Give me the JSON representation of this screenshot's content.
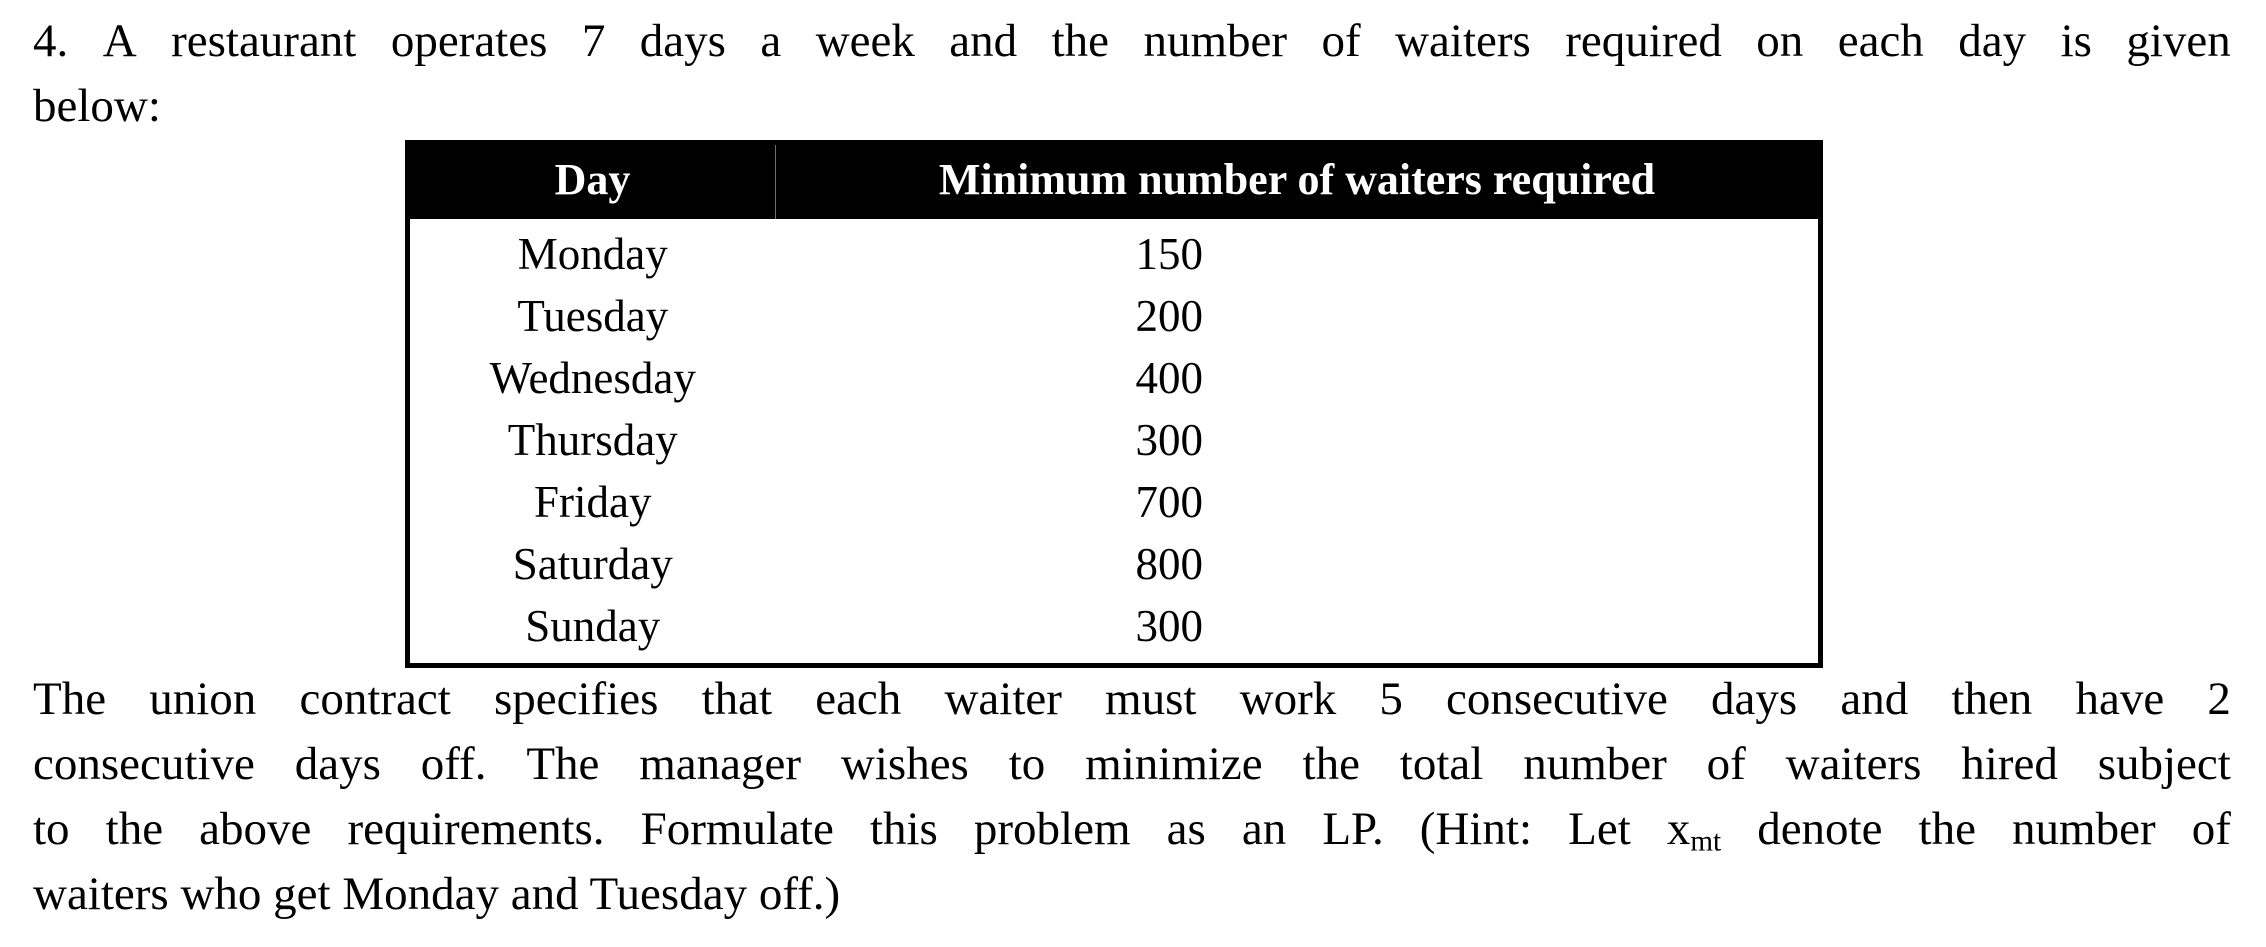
{
  "document": {
    "question_number": "4.",
    "intro": {
      "line1_words": [
        "4.",
        "A",
        "restaurant",
        "operates",
        "7",
        "days",
        "a",
        "week",
        "and",
        "the",
        "number",
        "of",
        "waiters",
        "required",
        "on",
        "each",
        "day",
        "is",
        "given"
      ],
      "line2": "below:",
      "full_text": "4. A restaurant operates 7 days a week and the number of waiters required on each day is given below:"
    },
    "table": {
      "headers": [
        "Day",
        "Minimum number of waiters required"
      ],
      "rows": [
        {
          "day": "Monday",
          "waiters": "150"
        },
        {
          "day": "Tuesday",
          "waiters": "200"
        },
        {
          "day": "Wednesday",
          "waiters": "400"
        },
        {
          "day": "Thursday",
          "waiters": "300"
        },
        {
          "day": "Friday",
          "waiters": "700"
        },
        {
          "day": "Saturday",
          "waiters": "800"
        },
        {
          "day": "Sunday",
          "waiters": "300"
        }
      ],
      "header_bg": "#000000",
      "header_fg": "#ffffff",
      "border_color": "#000000"
    },
    "closing": {
      "line1_words": [
        "The",
        "union",
        "contract",
        "specifies",
        "that",
        "each",
        "waiter",
        "must",
        "work",
        "5",
        "consecutive",
        "days",
        "and",
        "then",
        "have",
        "2"
      ],
      "line2_words": [
        "consecutive",
        "days",
        "off.",
        "The",
        "manager",
        "wishes",
        "to",
        "minimize",
        "the",
        "total",
        "number",
        "of",
        "waiters",
        "hired",
        "subject"
      ],
      "line3_a": "to the above requirements. Formulate this problem as an LP. (Hint: Let x",
      "line3_sub": "mt",
      "line3_b": " denote the number of",
      "line3_words_a": [
        "to",
        "the",
        "above",
        "requirements.",
        "Formulate",
        "this",
        "problem",
        "as",
        "an",
        "LP.",
        "(Hint:",
        "Let"
      ],
      "line4": "waiters who get Monday and Tuesday off.)",
      "full_text": "The union contract specifies that each waiter must work 5 consecutive days and then have 2 consecutive days off. The manager wishes to minimize the total number of waiters hired subject to the above requirements. Formulate this problem as an LP. (Hint: Let xmt denote the number of waiters who get Monday and Tuesday off.)"
    }
  }
}
